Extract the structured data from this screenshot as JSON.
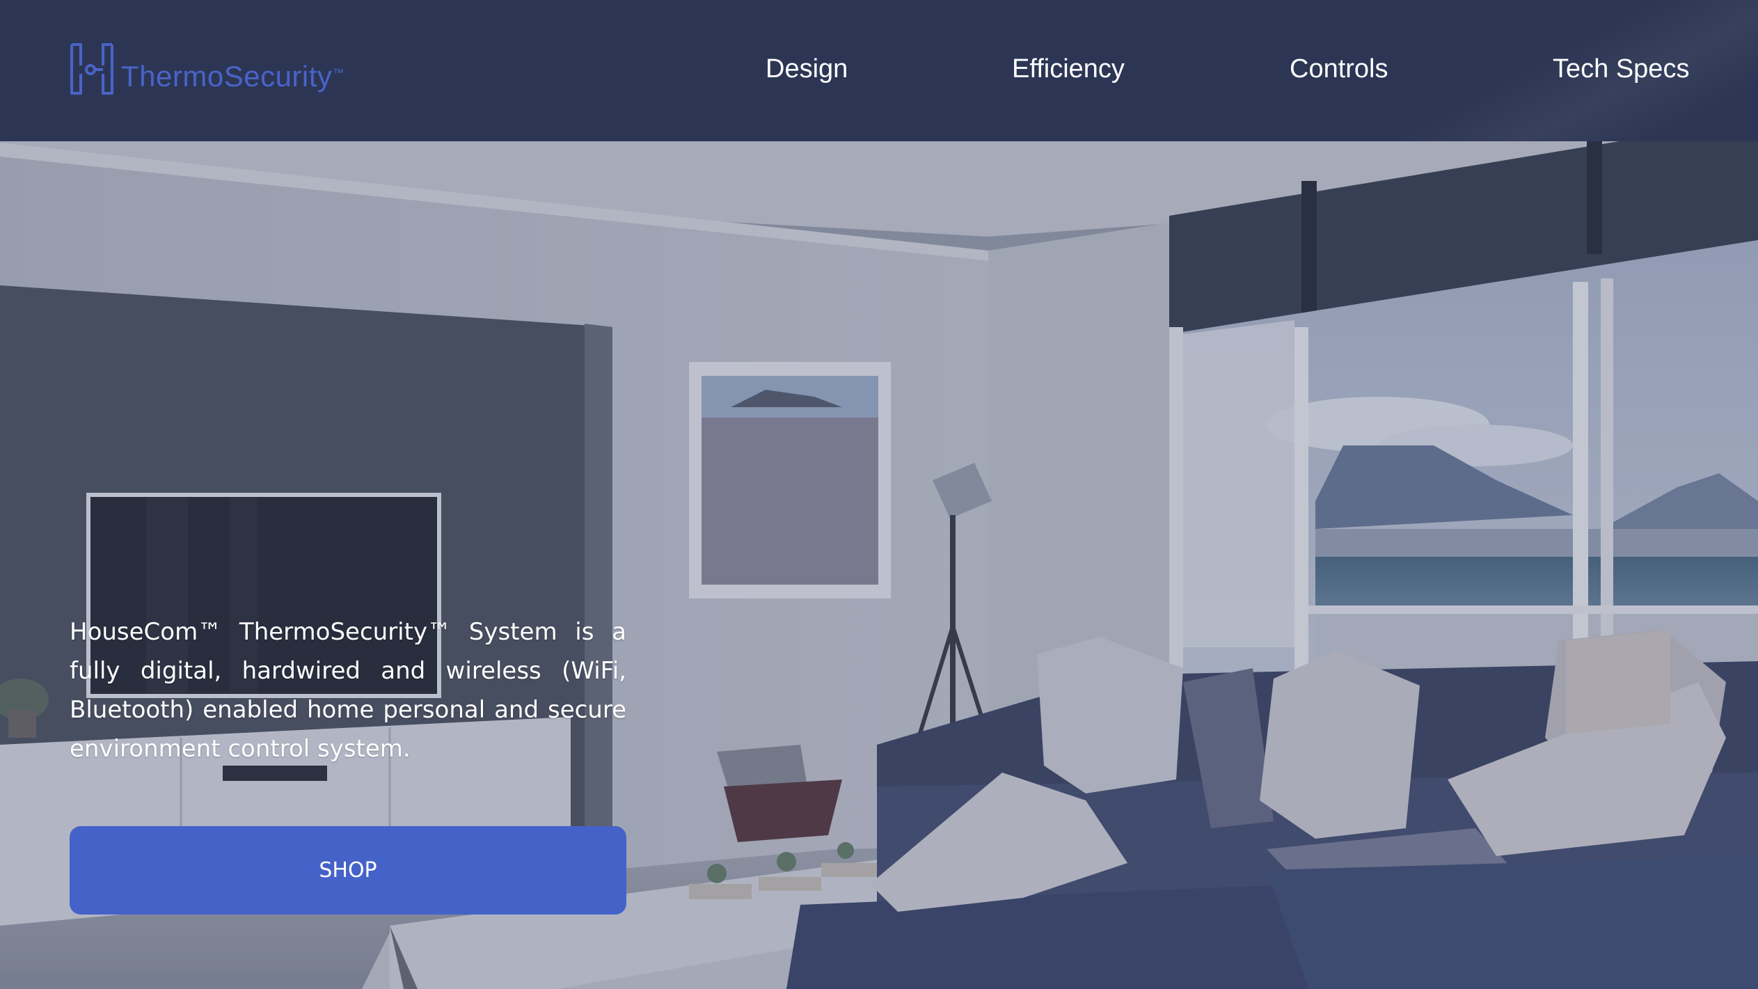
{
  "brand": {
    "name": "ThermoSecurity",
    "trademark": "™",
    "color": "#4a63c8"
  },
  "nav": {
    "items": [
      {
        "label": "Design"
      },
      {
        "label": "Efficiency"
      },
      {
        "label": "Controls"
      },
      {
        "label": "Tech Specs"
      }
    ]
  },
  "hero": {
    "description": "HouseCom™ ThermoSecurity™ System is a fully digital, hardwired and wireless (WiFi, Bluetooth) enabled home personal and secure environment control system.",
    "cta_label": "SHOP"
  },
  "colors": {
    "header_bg": "#2c3654",
    "button_bg": "#4562c8",
    "text": "#ffffff"
  }
}
